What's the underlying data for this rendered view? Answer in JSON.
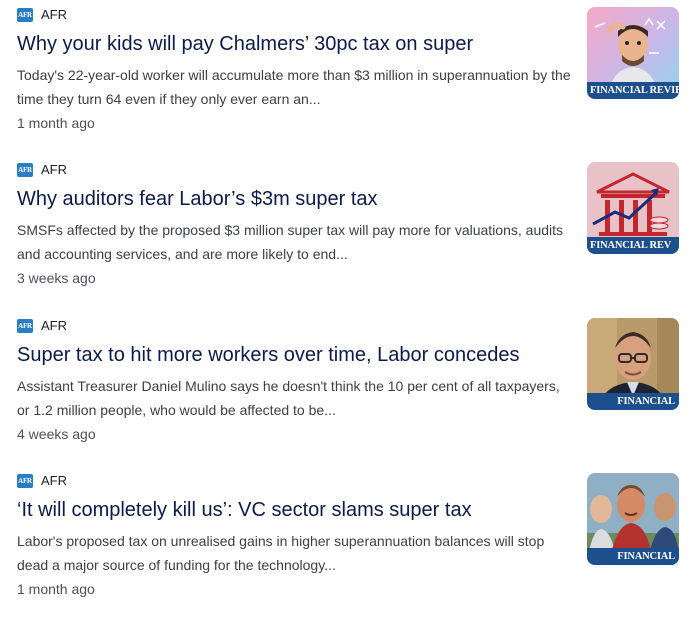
{
  "articles": [
    {
      "source": "AFR",
      "logo_text": "AFR",
      "headline": "Why your kids will pay Chalmers’ 30pc tax on super",
      "snippet": "Today's 22-year-old worker will accumulate more than $3 million in superannuation by the time they turn 64 even if they only ever earn an...",
      "time": "1 month ago",
      "thumb_banner": "FINANCIAL REVIEW"
    },
    {
      "source": "AFR",
      "logo_text": "AFR",
      "headline": "Why auditors fear Labor’s $3m super tax",
      "snippet": "SMSFs affected by the proposed $3 million super tax will pay more for valuations, audits and accounting services, and are more likely to end...",
      "time": "3 weeks ago",
      "thumb_banner": "FINANCIAL REV"
    },
    {
      "source": "AFR",
      "logo_text": "AFR",
      "headline": "Super tax to hit more workers over time, Labor concedes",
      "snippet": "Assistant Treasurer Daniel Mulino says he doesn't think the 10 per cent of all taxpayers, or 1.2 million people, who would be affected to be...",
      "time": "4 weeks ago",
      "thumb_banner": "FINANCIAL"
    },
    {
      "source": "AFR",
      "logo_text": "AFR",
      "headline": "‘It will completely kill us’: VC sector slams super tax",
      "snippet": "Labor's proposed tax on unrealised gains in higher superannuation balances will stop dead a major source of funding for the technology...",
      "time": "1 month ago",
      "thumb_banner": "FINANCIAL"
    }
  ],
  "colors": {
    "headline": "#0b1a4a",
    "snippet": "#3c4043",
    "timestamp": "#4d5156",
    "source_logo": "#2a7dc4",
    "thumb_banner": "#1d4f8c"
  }
}
